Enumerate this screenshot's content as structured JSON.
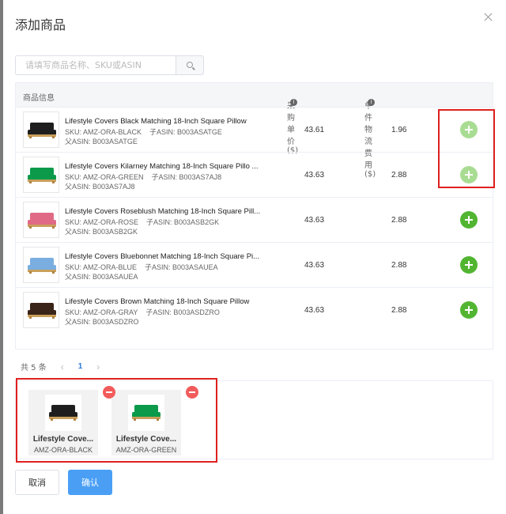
{
  "dialog": {
    "title": "添加商品"
  },
  "search": {
    "placeholder": "请填写商品名称、SKU或ASIN"
  },
  "table": {
    "headers": {
      "info": "商品信息",
      "price": "采购单价 ($)",
      "shipping": "单件物流费用 ($)"
    },
    "rows": [
      {
        "name": "Lifestyle Covers Black Matching 18-Inch Square Pillow",
        "sku": "SKU: AMZ-ORA-BLACK",
        "child": "子ASIN: B003ASATGE",
        "parent": "父ASIN: B003ASATGE",
        "price": "43.61",
        "shipping": "1.96",
        "added": true,
        "color": "#1e1e1e"
      },
      {
        "name": "Lifestyle Covers Kilarney Matching 18-Inch Square Pillo ...",
        "sku": "SKU: AMZ-ORA-GREEN",
        "child": "子ASIN: B003AS7AJ8",
        "parent": "父ASIN: B003AS7AJ8",
        "price": "43.63",
        "shipping": "2.88",
        "added": true,
        "color": "#0a9a4a"
      },
      {
        "name": "Lifestyle Covers Roseblush Matching 18-Inch Square Pill...",
        "sku": "SKU: AMZ-ORA-ROSE",
        "child": "子ASIN: B003ASB2GK",
        "parent": "父ASIN: B003ASB2GK",
        "price": "43.63",
        "shipping": "2.88",
        "added": false,
        "color": "#e06a86"
      },
      {
        "name": "Lifestyle Covers Bluebonnet Matching 18-Inch Square Pi...",
        "sku": "SKU: AMZ-ORA-BLUE",
        "child": "子ASIN: B003ASAUEA",
        "parent": "父ASIN: B003ASAUEA",
        "price": "43.63",
        "shipping": "2.88",
        "added": false,
        "color": "#7aaee0"
      },
      {
        "name": "Lifestyle Covers Brown Matching 18-Inch Square Pillow",
        "sku": "SKU: AMZ-ORA-GRAY",
        "child": "子ASIN: B003ASDZRO",
        "parent": "父ASIN: B003ASDZRO",
        "price": "43.63",
        "shipping": "2.88",
        "added": false,
        "color": "#3a2318"
      }
    ]
  },
  "pager": {
    "total": "共 5 条",
    "prev": "‹",
    "page": "1",
    "next": "›"
  },
  "selected": [
    {
      "name": "Lifestyle Cove...",
      "sku": "AMZ-ORA-BLACK",
      "color": "#1e1e1e"
    },
    {
      "name": "Lifestyle Cove...",
      "sku": "AMZ-ORA-GREEN",
      "color": "#0a9a4a"
    }
  ],
  "buttons": {
    "cancel": "取消",
    "ok": "确认"
  },
  "icons": {
    "info_icon": "i"
  }
}
